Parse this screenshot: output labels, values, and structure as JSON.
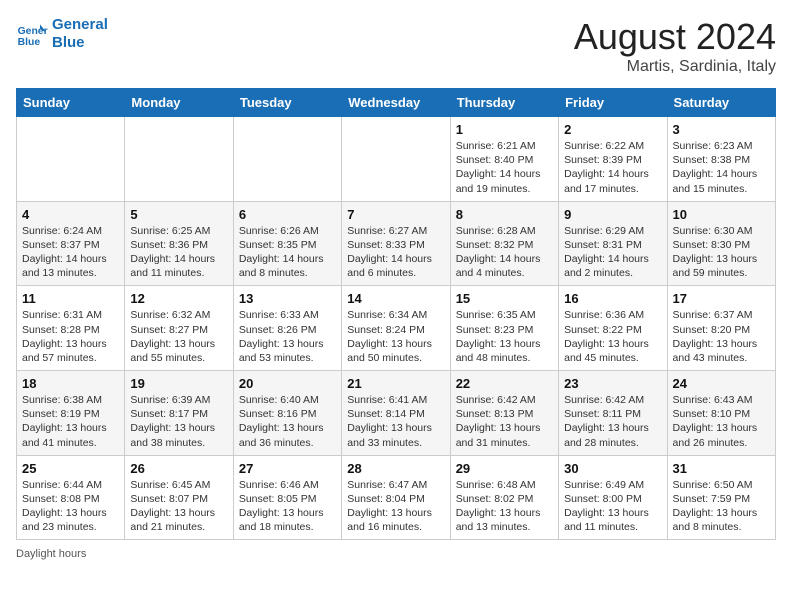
{
  "header": {
    "logo_line1": "General",
    "logo_line2": "Blue",
    "month_title": "August 2024",
    "location": "Martis, Sardinia, Italy"
  },
  "days_of_week": [
    "Sunday",
    "Monday",
    "Tuesday",
    "Wednesday",
    "Thursday",
    "Friday",
    "Saturday"
  ],
  "weeks": [
    [
      {
        "day": "",
        "info": ""
      },
      {
        "day": "",
        "info": ""
      },
      {
        "day": "",
        "info": ""
      },
      {
        "day": "",
        "info": ""
      },
      {
        "day": "1",
        "info": "Sunrise: 6:21 AM\nSunset: 8:40 PM\nDaylight: 14 hours and 19 minutes."
      },
      {
        "day": "2",
        "info": "Sunrise: 6:22 AM\nSunset: 8:39 PM\nDaylight: 14 hours and 17 minutes."
      },
      {
        "day": "3",
        "info": "Sunrise: 6:23 AM\nSunset: 8:38 PM\nDaylight: 14 hours and 15 minutes."
      }
    ],
    [
      {
        "day": "4",
        "info": "Sunrise: 6:24 AM\nSunset: 8:37 PM\nDaylight: 14 hours and 13 minutes."
      },
      {
        "day": "5",
        "info": "Sunrise: 6:25 AM\nSunset: 8:36 PM\nDaylight: 14 hours and 11 minutes."
      },
      {
        "day": "6",
        "info": "Sunrise: 6:26 AM\nSunset: 8:35 PM\nDaylight: 14 hours and 8 minutes."
      },
      {
        "day": "7",
        "info": "Sunrise: 6:27 AM\nSunset: 8:33 PM\nDaylight: 14 hours and 6 minutes."
      },
      {
        "day": "8",
        "info": "Sunrise: 6:28 AM\nSunset: 8:32 PM\nDaylight: 14 hours and 4 minutes."
      },
      {
        "day": "9",
        "info": "Sunrise: 6:29 AM\nSunset: 8:31 PM\nDaylight: 14 hours and 2 minutes."
      },
      {
        "day": "10",
        "info": "Sunrise: 6:30 AM\nSunset: 8:30 PM\nDaylight: 13 hours and 59 minutes."
      }
    ],
    [
      {
        "day": "11",
        "info": "Sunrise: 6:31 AM\nSunset: 8:28 PM\nDaylight: 13 hours and 57 minutes."
      },
      {
        "day": "12",
        "info": "Sunrise: 6:32 AM\nSunset: 8:27 PM\nDaylight: 13 hours and 55 minutes."
      },
      {
        "day": "13",
        "info": "Sunrise: 6:33 AM\nSunset: 8:26 PM\nDaylight: 13 hours and 53 minutes."
      },
      {
        "day": "14",
        "info": "Sunrise: 6:34 AM\nSunset: 8:24 PM\nDaylight: 13 hours and 50 minutes."
      },
      {
        "day": "15",
        "info": "Sunrise: 6:35 AM\nSunset: 8:23 PM\nDaylight: 13 hours and 48 minutes."
      },
      {
        "day": "16",
        "info": "Sunrise: 6:36 AM\nSunset: 8:22 PM\nDaylight: 13 hours and 45 minutes."
      },
      {
        "day": "17",
        "info": "Sunrise: 6:37 AM\nSunset: 8:20 PM\nDaylight: 13 hours and 43 minutes."
      }
    ],
    [
      {
        "day": "18",
        "info": "Sunrise: 6:38 AM\nSunset: 8:19 PM\nDaylight: 13 hours and 41 minutes."
      },
      {
        "day": "19",
        "info": "Sunrise: 6:39 AM\nSunset: 8:17 PM\nDaylight: 13 hours and 38 minutes."
      },
      {
        "day": "20",
        "info": "Sunrise: 6:40 AM\nSunset: 8:16 PM\nDaylight: 13 hours and 36 minutes."
      },
      {
        "day": "21",
        "info": "Sunrise: 6:41 AM\nSunset: 8:14 PM\nDaylight: 13 hours and 33 minutes."
      },
      {
        "day": "22",
        "info": "Sunrise: 6:42 AM\nSunset: 8:13 PM\nDaylight: 13 hours and 31 minutes."
      },
      {
        "day": "23",
        "info": "Sunrise: 6:42 AM\nSunset: 8:11 PM\nDaylight: 13 hours and 28 minutes."
      },
      {
        "day": "24",
        "info": "Sunrise: 6:43 AM\nSunset: 8:10 PM\nDaylight: 13 hours and 26 minutes."
      }
    ],
    [
      {
        "day": "25",
        "info": "Sunrise: 6:44 AM\nSunset: 8:08 PM\nDaylight: 13 hours and 23 minutes."
      },
      {
        "day": "26",
        "info": "Sunrise: 6:45 AM\nSunset: 8:07 PM\nDaylight: 13 hours and 21 minutes."
      },
      {
        "day": "27",
        "info": "Sunrise: 6:46 AM\nSunset: 8:05 PM\nDaylight: 13 hours and 18 minutes."
      },
      {
        "day": "28",
        "info": "Sunrise: 6:47 AM\nSunset: 8:04 PM\nDaylight: 13 hours and 16 minutes."
      },
      {
        "day": "29",
        "info": "Sunrise: 6:48 AM\nSunset: 8:02 PM\nDaylight: 13 hours and 13 minutes."
      },
      {
        "day": "30",
        "info": "Sunrise: 6:49 AM\nSunset: 8:00 PM\nDaylight: 13 hours and 11 minutes."
      },
      {
        "day": "31",
        "info": "Sunrise: 6:50 AM\nSunset: 7:59 PM\nDaylight: 13 hours and 8 minutes."
      }
    ]
  ],
  "footer": {
    "daylight_label": "Daylight hours"
  }
}
